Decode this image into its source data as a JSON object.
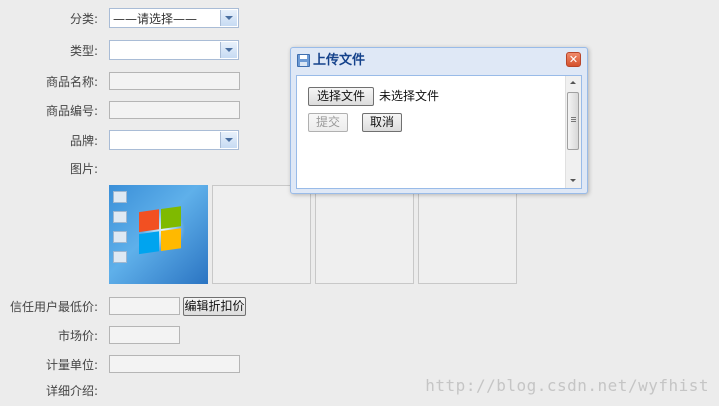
{
  "form": {
    "category_label": "分类:",
    "category_value": "——请选择——",
    "type_label": "类型:",
    "product_name_label": "商品名称:",
    "product_code_label": "商品编号:",
    "brand_label": "品牌:",
    "image_label": "图片:",
    "trusted_min_price_label": "信任用户最低价:",
    "edit_discount_button": "编辑折扣价",
    "market_price_label": "市场价:",
    "unit_label": "计量单位:",
    "details_label": "详细介绍:"
  },
  "dialog": {
    "title": "上传文件",
    "close_symbol": "✕",
    "choose_file_button": "选择文件",
    "no_file_text": "未选择文件",
    "submit_button": "提交",
    "cancel_button": "取消"
  },
  "watermark": "http://blog.csdn.net/wyfhist",
  "colors": {
    "accent": "#15428b",
    "dialog_border": "#99bbe8",
    "close": "#d5522d"
  },
  "icons": [
    "save-icon",
    "close-icon",
    "chevron-down-icon",
    "scroll-up-icon",
    "scroll-down-icon"
  ]
}
